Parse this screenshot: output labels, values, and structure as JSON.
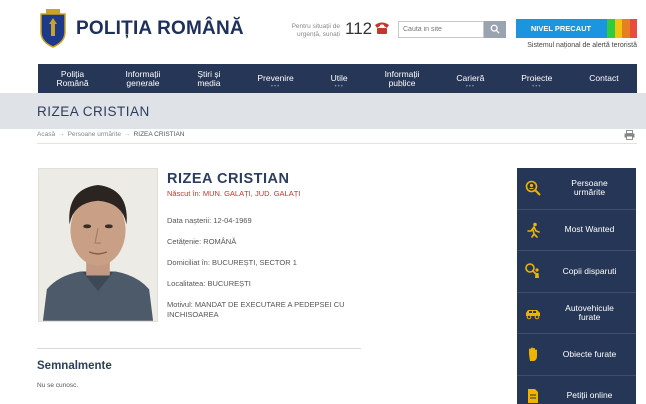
{
  "header": {
    "brand": "POLIȚIA ROMÂNĂ",
    "emergency_text": "Pentru situații de urgență, sunați",
    "emergency_number": "112",
    "search_placeholder": "Cauta in site",
    "alert_level": "NIVEL PRECAUT",
    "alert_system": "Sistemul național de alertă teroristă",
    "alert_colors": [
      "#2ecc40",
      "#f1c40f",
      "#e67e22",
      "#e74c3c"
    ]
  },
  "nav": {
    "items": [
      {
        "label": "Poliția\nRomână"
      },
      {
        "label": "Informații\ngenerale"
      },
      {
        "label": "Știri și\nmedia"
      },
      {
        "label": "Prevenire"
      },
      {
        "label": "Utile"
      },
      {
        "label": "Informații\npublice"
      },
      {
        "label": "Carieră"
      },
      {
        "label": "Proiecte"
      },
      {
        "label": "Contact"
      }
    ]
  },
  "page": {
    "title": "RIZEA CRISTIAN"
  },
  "breadcrumb": {
    "home": "Acasă",
    "section": "Persoane urmărite",
    "current": "RIZEA CRISTIAN"
  },
  "profile": {
    "name": "RIZEA CRISTIAN",
    "born": "Născut în: MUN. GALAȚI, JUD. GALAȚI",
    "birth_date": "Data nașterii: 12-04-1969",
    "citizenship": "Cetățenie: ROMÂNĂ",
    "domicile": "Domiciliat în: BUCUREȘTI, SECTOR 1",
    "locality": "Localitatea: BUCUREȘTI",
    "reason": "Motivul: MANDAT DE EXECUTARE A PEDEPSEI CU INCHISOAREA"
  },
  "semnalmente": {
    "title": "Semnalmente",
    "text": "Nu se cunosc."
  },
  "sidebar": {
    "items": [
      {
        "label": "Persoane\nurmărite",
        "icon": "search-person-icon"
      },
      {
        "label": "Most Wanted",
        "icon": "running-person-icon"
      },
      {
        "label": "Copii disparuti",
        "icon": "child-search-icon"
      },
      {
        "label": "Autovehicule\nfurate",
        "icon": "car-icon"
      },
      {
        "label": "Obiecte furate",
        "icon": "hand-icon"
      },
      {
        "label": "Petiții online",
        "icon": "document-icon"
      }
    ]
  }
}
